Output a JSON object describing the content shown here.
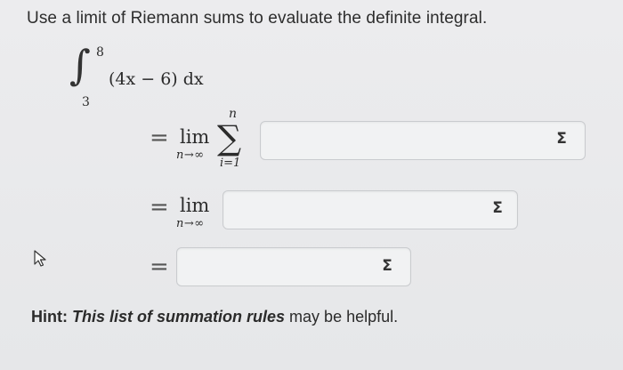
{
  "problem": {
    "instruction": "Use a limit of Riemann sums to evaluate the definite integral."
  },
  "integral": {
    "sign": "∫",
    "upper": "8",
    "lower": "3",
    "integrand": "(4x − 6) dx"
  },
  "step1": {
    "equals": "=",
    "lim": "lim",
    "lim_sub": "n→∞",
    "sigma": "∑",
    "sigma_top": "n",
    "sigma_bottom": "i=1",
    "input_value": "",
    "sigma_button": "Σ"
  },
  "step2": {
    "equals": "=",
    "lim": "lim",
    "lim_sub": "n→∞",
    "input_value": "",
    "sigma_button": "Σ"
  },
  "step3": {
    "equals": "=",
    "input_value": "",
    "sigma_button": "Σ"
  },
  "hint": {
    "prefix": "Hint:",
    "link_text": "This list of summation rules",
    "suffix": " may be helpful."
  },
  "colors": {
    "background": "#e9eaec",
    "box_border": "#c9cbce",
    "box_fill": "#f1f2f3",
    "text": "#2b2b2b"
  },
  "icons": {
    "cursor": "mouse-pointer-icon",
    "sigma": "sigma-icon"
  }
}
